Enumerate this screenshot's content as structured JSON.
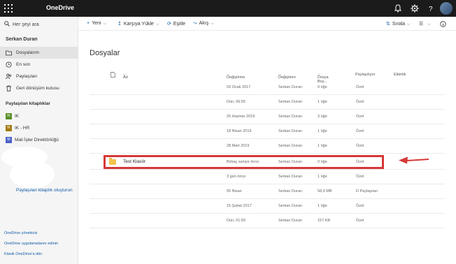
{
  "app": {
    "name": "OneDrive"
  },
  "topbar": {
    "icons": [
      "bell-icon",
      "gear-icon",
      "help-icon",
      "avatar"
    ]
  },
  "sidebar": {
    "search_placeholder": "Her şeyi ara",
    "user": "Serkan Duran",
    "nav": [
      {
        "label": "Dosyalarım",
        "icon": "folder-icon",
        "active": true
      },
      {
        "label": "En son",
        "icon": "clock-icon"
      },
      {
        "label": "Paylaşılan",
        "icon": "people-icon"
      },
      {
        "label": "Geri dönüşüm kutusu",
        "icon": "trash-icon"
      }
    ],
    "libraries_header": "Paylaşılan kitaplıklar",
    "libraries": [
      {
        "label": "IK",
        "badge": "IK",
        "color": "#5b8f2a"
      },
      {
        "label": "IK - HR",
        "badge": "IK",
        "color": "#a27a10"
      },
      {
        "label": "Mali İşler Direktörlüğü",
        "badge": "M",
        "color": "#4a63c9"
      }
    ],
    "create_library": "Paylaşılan kitaplık oluşturun",
    "footer": [
      "OneDrive yöneticisi",
      "OneDrive uygulamalarını edinin",
      "Klasik OneDrive'a dön"
    ]
  },
  "commands": {
    "new": "Yeni",
    "upload": "Karşıya Yükle",
    "sync": "Eşitle",
    "flow": "Akış",
    "sort": "Sırala"
  },
  "main": {
    "title": "Dosyalar",
    "columns": [
      "Ad",
      "Değiştirme",
      "Değiştiren",
      "Dosya Boy...",
      "Paylaşılıyor",
      "Etkinlik"
    ],
    "rows": [
      {
        "name": "",
        "modified": "03 Ocak 2017",
        "by": "Serkan Duran",
        "size": "0 öğe",
        "sharing": "Özel"
      },
      {
        "name": "",
        "modified": "Dün, 06:55",
        "by": "Serkan Duran",
        "size": "1 öğe",
        "sharing": "Özel"
      },
      {
        "name": "",
        "modified": "25 Haziran 2019",
        "by": "Serkan Duran",
        "size": "3 öğe",
        "sharing": "Özel"
      },
      {
        "name": "",
        "modified": "18 Nisan 2019",
        "by": "Serkan Duran",
        "size": "1 öğe",
        "sharing": "Özel"
      },
      {
        "name": "",
        "modified": "28 Mart 2019",
        "by": "Serkan Duran",
        "size": "1 öğe",
        "sharing": "Özel"
      },
      {
        "name": "Test Klasör",
        "modified": "Birkaç saniye önce",
        "by": "Serkan Duran",
        "size": "0 öğe",
        "sharing": "Özel"
      },
      {
        "name": "",
        "modified": "3 gün önce",
        "by": "Serkan Duran",
        "size": "1 öğe",
        "sharing": "Özel"
      },
      {
        "name": "",
        "modified": "05 Nisan",
        "by": "Serkan Duran",
        "size": "58,9 MB",
        "sharing": "D Paylaşılan"
      },
      {
        "name": "",
        "modified": "15 Şubat 2017",
        "by": "Serkan Duran",
        "size": "1 öğe",
        "sharing": "Özel"
      },
      {
        "name": "",
        "modified": "Dün, 01:59",
        "by": "Serkan Duran",
        "size": "157 KB",
        "sharing": "Özel"
      }
    ]
  },
  "colors": {
    "accent": "#0f5ba7",
    "highlight": "#d63838",
    "folder": "#f4c24d"
  }
}
